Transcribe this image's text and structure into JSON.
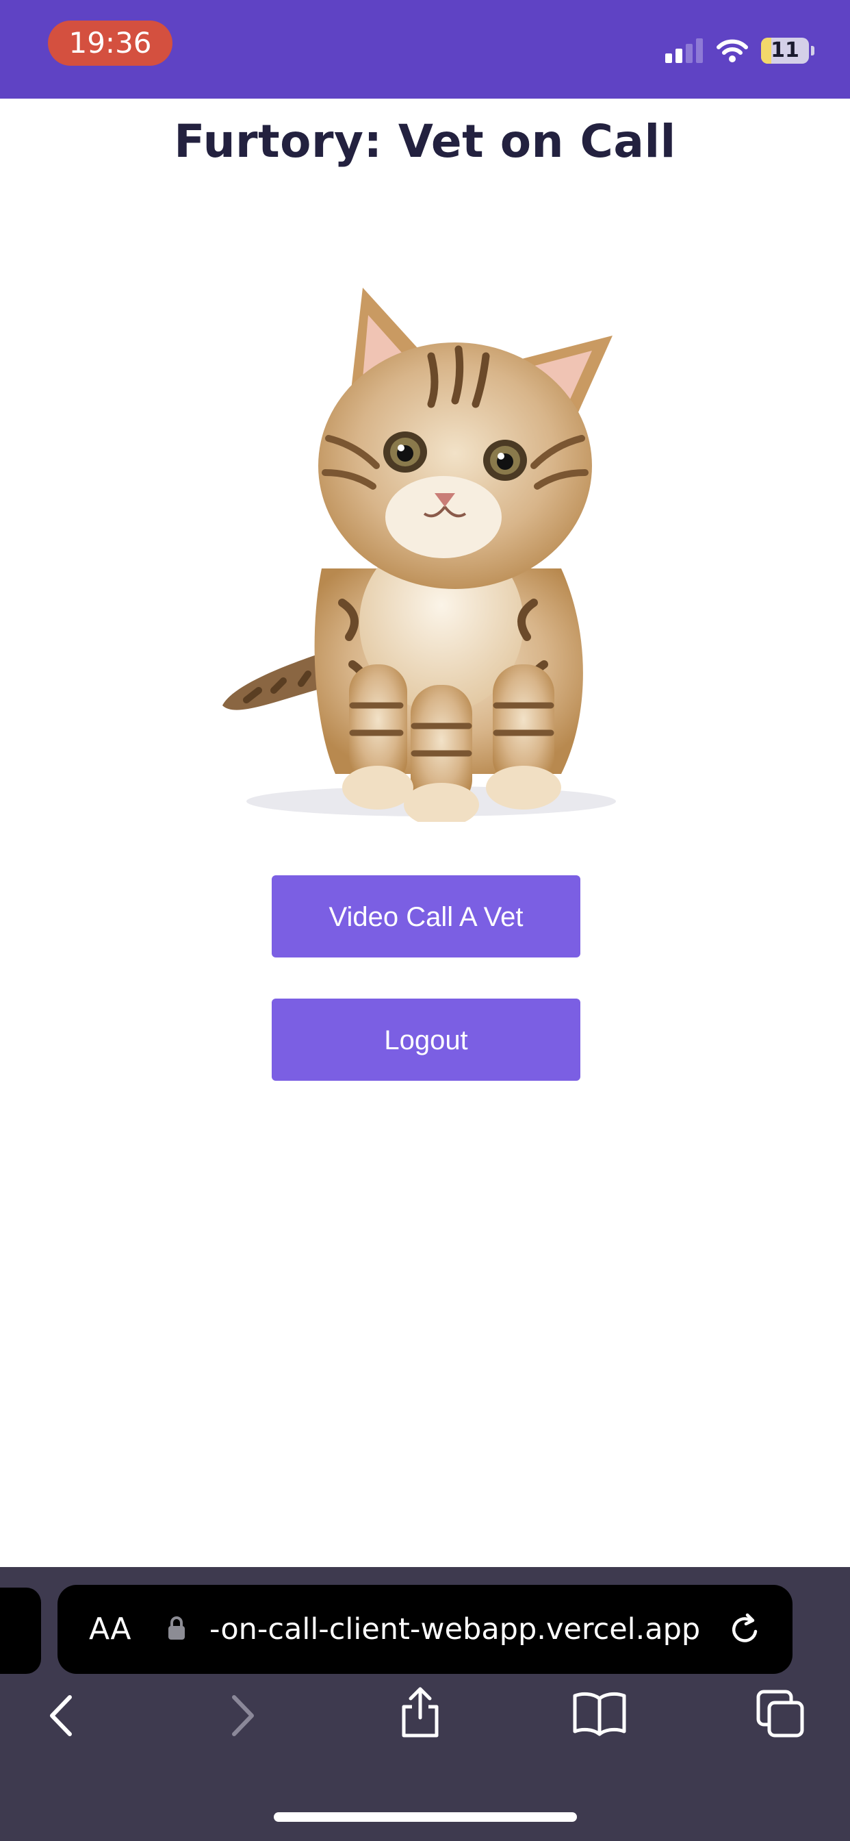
{
  "status_bar": {
    "time": "19:36",
    "battery_level": "11",
    "battery_fraction": 0.11,
    "accent_color": "#5f43c4"
  },
  "page": {
    "title": "Furtory: Vet on Call",
    "hero_image": "kitten-image",
    "buttons": {
      "video_call": "Video Call A Vet",
      "logout": "Logout"
    },
    "button_color": "#7b5fe3"
  },
  "browser": {
    "text_size_label": "AA",
    "url": "-on-call-client-webapp.vercel.app",
    "icons": [
      "lock-icon",
      "reload-icon",
      "back-icon",
      "forward-icon",
      "share-icon",
      "bookmarks-icon",
      "tabs-icon"
    ]
  }
}
